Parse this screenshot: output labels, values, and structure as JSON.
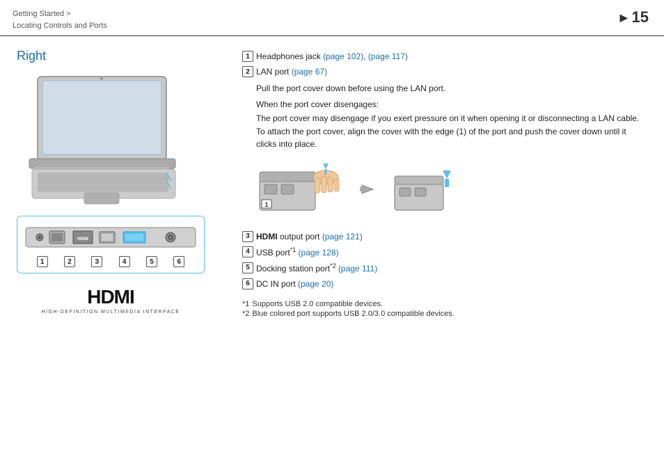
{
  "header": {
    "breadcrumb_line1": "Getting Started >",
    "breadcrumb_line2": "Locating Controls and Ports",
    "page_number": "15",
    "arrow": "▶"
  },
  "section": {
    "title": "Right"
  },
  "items": [
    {
      "num": "1",
      "label": "Headphones jack",
      "links": [
        "(page 102)",
        "(page 117)"
      ],
      "sub": ""
    },
    {
      "num": "2",
      "label": "LAN port",
      "links": [
        "(page 67)"
      ],
      "sub": "Pull the port cover down before using the LAN port."
    },
    {
      "num": "3",
      "label_bold": "HDMI",
      "label_rest": " output port",
      "links": [
        "(page 121)"
      ],
      "sub": ""
    },
    {
      "num": "4",
      "label": "USB port",
      "sup": "*1",
      "links": [
        "(page 128)"
      ],
      "sub": ""
    },
    {
      "num": "5",
      "label": "Docking station port",
      "sup": "*2",
      "links": [
        "(page 111)"
      ],
      "sub": ""
    },
    {
      "num": "6",
      "label": "DC IN port",
      "links": [
        "(page 20)"
      ],
      "sub": ""
    }
  ],
  "lan_desc": {
    "heading": "When the port cover disengages:",
    "body": "The port cover may disengage if you exert pressure on it when opening it or disconnecting a LAN cable. To attach the port cover, align the cover with the edge (1) of the port and push the cover down until it clicks into place."
  },
  "footnotes": [
    {
      "num": "*1",
      "text": "Supports USB 2.0 compatible devices."
    },
    {
      "num": "*2",
      "text": "Blue colored port supports USB 2.0/3.0 compatible devices."
    }
  ],
  "hdmi": {
    "logo": "HDMI",
    "sub": "HIGH-DEFINITION MULTIMEDIA INTERFACE"
  },
  "port_labels": [
    "1",
    "2",
    "3",
    "4",
    "5",
    "6"
  ]
}
